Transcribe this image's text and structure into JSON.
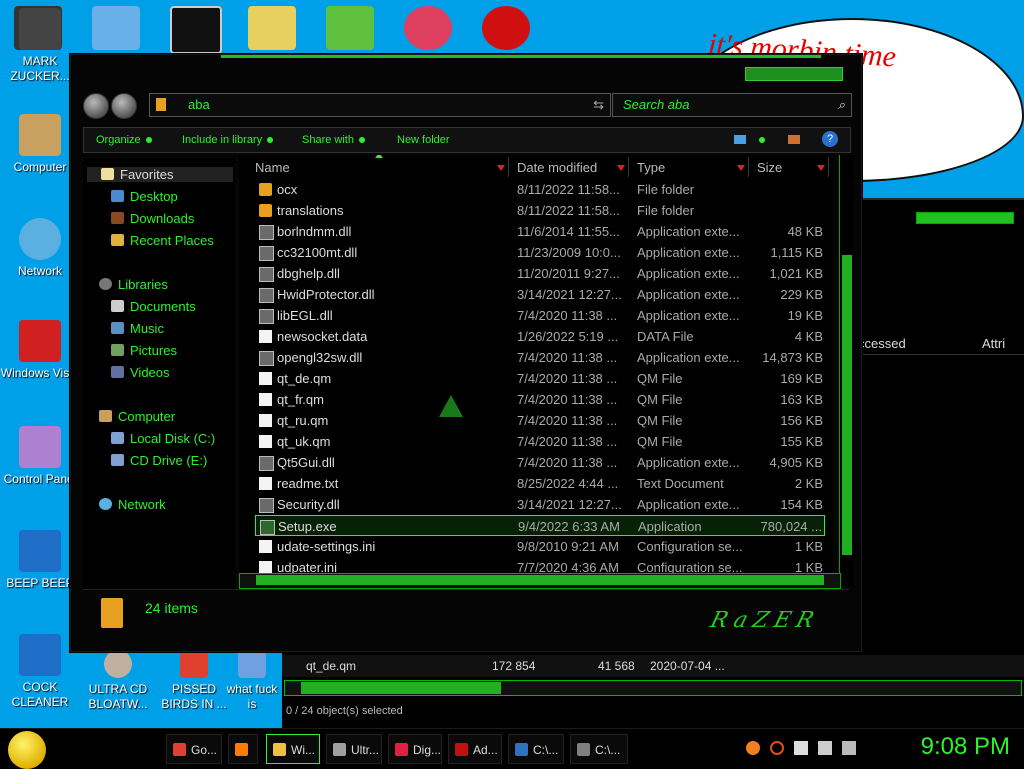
{
  "desktop": {
    "bubble_text": "it's morbin time",
    "left_icons": [
      {
        "label": "MARK ZUCKER...",
        "color": "#444"
      },
      {
        "label": "Computer",
        "color": "#c8a060"
      },
      {
        "label": "Network",
        "color": "#5ab0e0"
      },
      {
        "label": "Windows Vista",
        "color": "#d02020"
      },
      {
        "label": "Control Panel",
        "color": "#b080d0"
      },
      {
        "label": "BEEP BEEP",
        "color": "#1e6ec8"
      },
      {
        "label": "COCK CLEANER",
        "color": "#1e6ec8"
      }
    ],
    "bottom_icons": [
      {
        "label": "ULTRA CD BLOATW..."
      },
      {
        "label": "PISSED BIRDS IN ..."
      },
      {
        "label": "what fuck is"
      }
    ]
  },
  "background_window": {
    "header_accessed": "ccessed",
    "header_attrib": "Attri",
    "row": {
      "name": "qt_de.qm",
      "size": "172 854",
      "packed": "41 568",
      "date": "2020-07-04 ..."
    },
    "status": "0 / 24 object(s) selected"
  },
  "window": {
    "address": "aba",
    "search_placeholder": "Search aba",
    "toolbar": {
      "organize": "Organize",
      "include": "Include in library",
      "share": "Share with",
      "new_folder": "New folder"
    },
    "nav": {
      "favorites": "Favorites",
      "desktop": "Desktop",
      "downloads": "Downloads",
      "recent": "Recent Places",
      "libraries": "Libraries",
      "documents": "Documents",
      "music": "Music",
      "pictures": "Pictures",
      "videos": "Videos",
      "computer": "Computer",
      "local_disk": "Local Disk (C:)",
      "cd_drive": "CD Drive (E:)",
      "network": "Network"
    },
    "columns": {
      "name": "Name",
      "date": "Date modified",
      "type": "Type",
      "size": "Size"
    },
    "files": [
      {
        "name": "ocx",
        "date": "8/11/2022 11:58...",
        "type": "File folder",
        "size": "",
        "kind": "folder"
      },
      {
        "name": "translations",
        "date": "8/11/2022 11:58...",
        "type": "File folder",
        "size": "",
        "kind": "folder"
      },
      {
        "name": "borlndmm.dll",
        "date": "11/6/2014 11:55...",
        "type": "Application exte...",
        "size": "48 KB",
        "kind": "dll"
      },
      {
        "name": "cc32100mt.dll",
        "date": "11/23/2009 10:0...",
        "type": "Application exte...",
        "size": "1,115 KB",
        "kind": "dll"
      },
      {
        "name": "dbghelp.dll",
        "date": "11/20/2011 9:27...",
        "type": "Application exte...",
        "size": "1,021 KB",
        "kind": "dll"
      },
      {
        "name": "HwidProtector.dll",
        "date": "3/14/2021 12:27...",
        "type": "Application exte...",
        "size": "229 KB",
        "kind": "dll"
      },
      {
        "name": "libEGL.dll",
        "date": "7/4/2020 11:38 ...",
        "type": "Application exte...",
        "size": "19 KB",
        "kind": "dll"
      },
      {
        "name": "newsocket.data",
        "date": "1/26/2022 5:19 ...",
        "type": "DATA File",
        "size": "4 KB",
        "kind": "doc"
      },
      {
        "name": "opengl32sw.dll",
        "date": "7/4/2020 11:38 ...",
        "type": "Application exte...",
        "size": "14,873 KB",
        "kind": "dll"
      },
      {
        "name": "qt_de.qm",
        "date": "7/4/2020 11:38 ...",
        "type": "QM File",
        "size": "169 KB",
        "kind": "doc"
      },
      {
        "name": "qt_fr.qm",
        "date": "7/4/2020 11:38 ...",
        "type": "QM File",
        "size": "163 KB",
        "kind": "doc"
      },
      {
        "name": "qt_ru.qm",
        "date": "7/4/2020 11:38 ...",
        "type": "QM File",
        "size": "156 KB",
        "kind": "doc"
      },
      {
        "name": "qt_uk.qm",
        "date": "7/4/2020 11:38 ...",
        "type": "QM File",
        "size": "155 KB",
        "kind": "doc"
      },
      {
        "name": "Qt5Gui.dll",
        "date": "7/4/2020 11:38 ...",
        "type": "Application exte...",
        "size": "4,905 KB",
        "kind": "dll"
      },
      {
        "name": "readme.txt",
        "date": "8/25/2022 4:44 ...",
        "type": "Text Document",
        "size": "2 KB",
        "kind": "doc"
      },
      {
        "name": "Security.dll",
        "date": "3/14/2021 12:27...",
        "type": "Application exte...",
        "size": "154 KB",
        "kind": "dll"
      },
      {
        "name": "Setup.exe",
        "date": "9/4/2022 6:33 AM",
        "type": "Application",
        "size": "780,024 ...",
        "kind": "exe",
        "selected": true
      },
      {
        "name": "udate-settings.ini",
        "date": "9/8/2010 9:21 AM",
        "type": "Configuration se...",
        "size": "1 KB",
        "kind": "doc"
      },
      {
        "name": "udpater.ini",
        "date": "7/7/2020 4:36 AM",
        "type": "Configuration se...",
        "size": "1 KB",
        "kind": "doc"
      }
    ],
    "item_count": "24 items",
    "logo": "RaZER"
  },
  "taskbar": {
    "buttons": [
      {
        "label": "Go...",
        "color": "#e04030"
      },
      {
        "label": "",
        "color": "#ff7a00"
      },
      {
        "label": "Wi...",
        "color": "#f0c040",
        "active": true
      },
      {
        "label": "Ultr...",
        "color": "#a0a0a0"
      },
      {
        "label": "Dig...",
        "color": "#e02040"
      },
      {
        "label": "Ad...",
        "color": "#c01010"
      },
      {
        "label": "C:\\...",
        "color": "#3070c0"
      },
      {
        "label": "C:\\...",
        "color": "#808080"
      }
    ],
    "clock": "9:08 PM"
  }
}
